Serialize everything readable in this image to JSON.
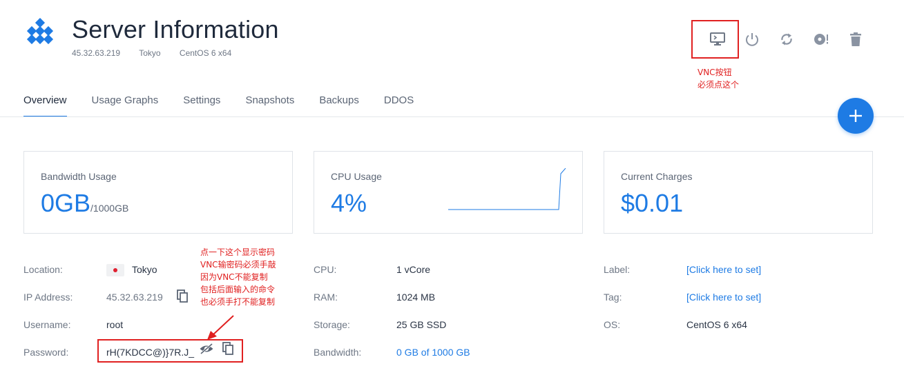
{
  "header": {
    "title": "Server Information",
    "ip": "45.32.63.219",
    "location": "Tokyo",
    "os": "CentOS 6 x64"
  },
  "actions": [
    {
      "name": "vnc-console",
      "icon": "monitor-icon"
    },
    {
      "name": "power",
      "icon": "power-icon"
    },
    {
      "name": "restart",
      "icon": "refresh-icon"
    },
    {
      "name": "reinstall",
      "icon": "disc-icon"
    },
    {
      "name": "destroy",
      "icon": "trash-icon"
    }
  ],
  "annotations": {
    "vnc_note_line1": "VNC按钮",
    "vnc_note_line2": "必须点这个",
    "pw_note_lines": [
      "点一下这个显示密码",
      "VNC输密码必须手敲",
      "因为VNC不能复制",
      "包括后面输入的命令",
      "也必须手打不能复制"
    ],
    "color": "#e02020"
  },
  "tabs": [
    "Overview",
    "Usage Graphs",
    "Settings",
    "Snapshots",
    "Backups",
    "DDOS"
  ],
  "active_tab": "Overview",
  "cards": {
    "bandwidth": {
      "label": "Bandwidth Usage",
      "value": "0GB",
      "suffix": "/1000GB"
    },
    "cpu": {
      "label": "CPU Usage",
      "value": "4%"
    },
    "charges": {
      "label": "Current Charges",
      "value": "$0.01"
    }
  },
  "details_left": {
    "location_label": "Location:",
    "location_value": "Tokyo",
    "ip_label": "IP Address:",
    "ip_value": "45.32.63.219",
    "username_label": "Username:",
    "username_value": "root",
    "password_label": "Password:",
    "password_value": "rH(7KDCC@)}7R.J_"
  },
  "details_mid": {
    "cpu_label": "CPU:",
    "cpu_value": "1 vCore",
    "ram_label": "RAM:",
    "ram_value": "1024 MB",
    "storage_label": "Storage:",
    "storage_value": "25 GB SSD",
    "bandwidth_label": "Bandwidth:",
    "bandwidth_value": "0 GB of 1000 GB"
  },
  "details_right": {
    "label_label": "Label:",
    "label_value": "[Click here to set]",
    "tag_label": "Tag:",
    "tag_value": "[Click here to set]",
    "os_label": "OS:",
    "os_value": "CentOS 6 x64"
  },
  "colors": {
    "accent": "#1e7be4",
    "annotation": "#e02020"
  }
}
